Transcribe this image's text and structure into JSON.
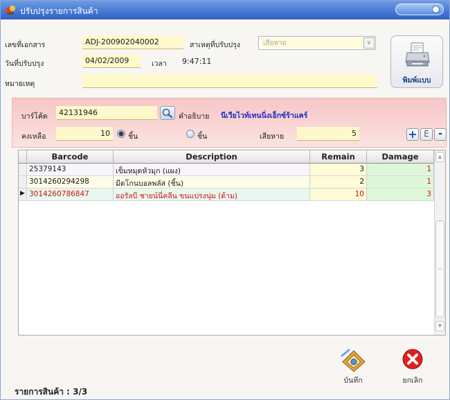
{
  "window": {
    "title": "ปรับปรุงรายการสินค้า"
  },
  "header": {
    "doc_no_label": "เลขที่เอกสาร",
    "doc_no": "ADJ-200902040002",
    "reason_label": "สาเหตุที่ปรับปรุง",
    "reason_value": "เสียหาย",
    "date_label": "วันที่ปรับปรุง",
    "date": "04/02/2009",
    "time_label": "เวลา",
    "time": "9:47:11",
    "note_label": "หมายเหตุ",
    "note": "",
    "print_label": "พิมพ์แบบ"
  },
  "entry": {
    "barcode_label": "บาร์โค้ด",
    "barcode": "42131946",
    "desc_label": "คำอธิบาย",
    "desc": "นีเวียไวท์เทนนิ่งเอ็กซ์ร้าแคร์",
    "remain_label": "คงเหลือ",
    "remain": "10",
    "radio1_label": "ชิ้น",
    "radio2_label": "ชิ้น",
    "damage_label": "เสียหาย",
    "damage": "5",
    "add_label": "+",
    "edit_label": "E",
    "remove_label": "-"
  },
  "grid": {
    "columns": [
      "Barcode",
      "Description",
      "Remain",
      "Damage"
    ],
    "rows": [
      {
        "barcode": "25379143",
        "description": "เข็มหมุดหัวมุก (แผง)",
        "remain": "3",
        "damage": "1"
      },
      {
        "barcode": "3014260294298",
        "description": "มีดโกนบอลพลัส (ชิ้น)",
        "remain": "2",
        "damage": "1"
      },
      {
        "barcode": "3014260786847",
        "description": "ออรัลบี ชายน์นี่คลีน ขนแปรงนุ่ม (ด้าม)",
        "remain": "10",
        "damage": "3"
      }
    ],
    "selected_row": 3
  },
  "footer": {
    "status": "รายการสินค้า : 3/3",
    "save_label": "บันทึก",
    "cancel_label": "ยกเลิก"
  },
  "colors": {
    "titlebar": "#3a6fd0",
    "field_bg": "#fff8cc",
    "entry_panel": "#f7c6c6",
    "selected_text": "#d01010",
    "desc_text": "#1d2cc0",
    "damage_col": "#dff7d9",
    "cancel_red": "#e02020"
  }
}
